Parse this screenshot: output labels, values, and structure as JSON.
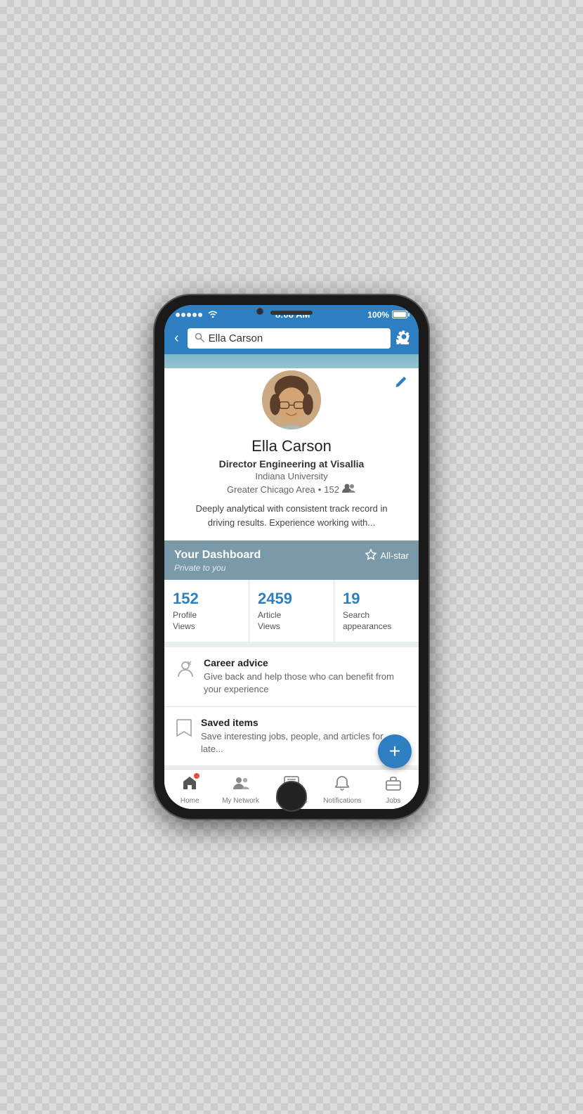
{
  "status": {
    "time": "8:08 AM",
    "battery": "100%",
    "signal_dots": 5
  },
  "search_bar": {
    "back_label": "‹",
    "query": "Ella Carson",
    "settings_label": "⚙"
  },
  "profile": {
    "name": "Ella Carson",
    "title": "Director Engineering at Visallia",
    "school": "Indiana University",
    "location": "Greater Chicago Area",
    "connections": "152",
    "bio": "Deeply analytical with consistent track record in driving results. Experience working with...",
    "edit_label": "✎"
  },
  "dashboard": {
    "title": "Your Dashboard",
    "subtitle": "Private to you",
    "allstar_label": "All-star",
    "stats": [
      {
        "number": "152",
        "label": "Profile\nViews"
      },
      {
        "number": "2459",
        "label": "Article\nViews"
      },
      {
        "number": "19",
        "label": "Search\nappearances"
      }
    ]
  },
  "action_items": [
    {
      "title": "Career advice",
      "description": "Give back and help those who can benefit from your experience"
    },
    {
      "title": "Saved items",
      "description": "Save interesting jobs, people, and articles for late..."
    }
  ],
  "bottom_nav": [
    {
      "label": "Home",
      "icon": "home",
      "has_badge": true
    },
    {
      "label": "My Network",
      "icon": "network",
      "has_badge": false
    },
    {
      "label": "Messages",
      "icon": "messages",
      "has_badge": false
    },
    {
      "label": "Notifications",
      "icon": "notifications",
      "has_badge": false
    },
    {
      "label": "Jobs",
      "icon": "jobs",
      "has_badge": false
    }
  ],
  "fab": {
    "label": "+"
  }
}
